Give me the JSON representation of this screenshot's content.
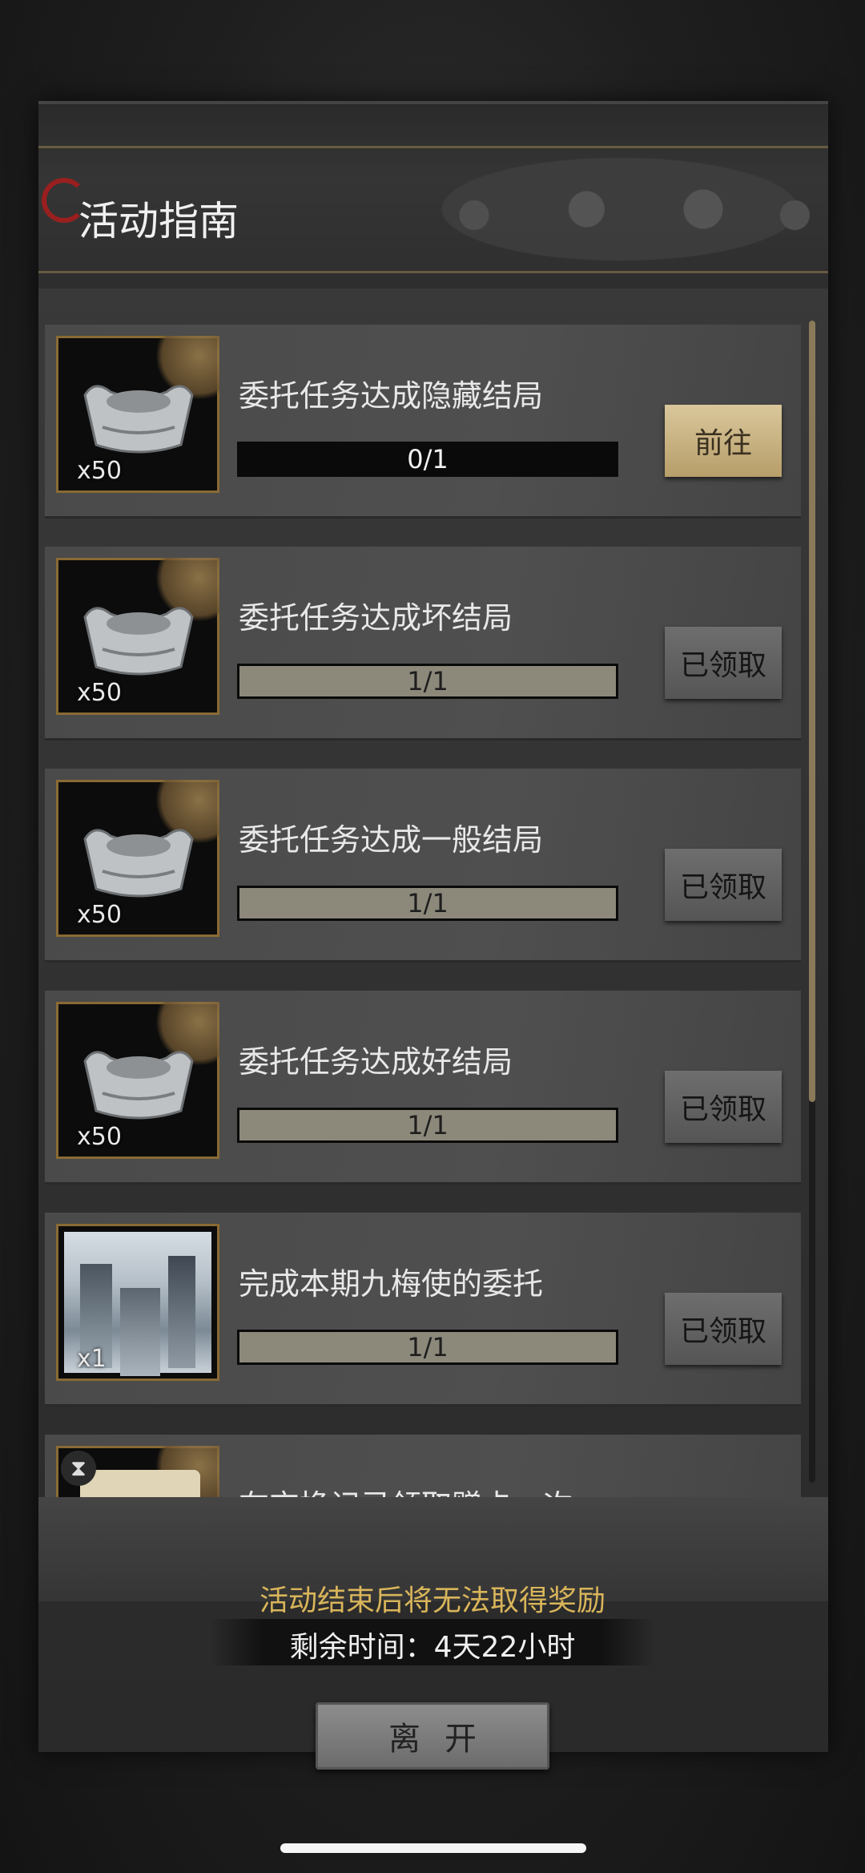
{
  "header": {
    "title": "活动指南"
  },
  "tasks": [
    {
      "title": "委托任务达成隐藏结局",
      "progress": "0/1",
      "progress_fraction": 0,
      "reward_qty": "x50",
      "reward_icon": "silver-ingot-icon",
      "button": "前往",
      "state": "go"
    },
    {
      "title": "委托任务达成坏结局",
      "progress": "1/1",
      "progress_fraction": 1,
      "reward_qty": "x50",
      "reward_icon": "silver-ingot-icon",
      "button": "已领取",
      "state": "claimed"
    },
    {
      "title": "委托任务达成一般结局",
      "progress": "1/1",
      "progress_fraction": 1,
      "reward_qty": "x50",
      "reward_icon": "silver-ingot-icon",
      "button": "已领取",
      "state": "claimed"
    },
    {
      "title": "委托任务达成好结局",
      "progress": "1/1",
      "progress_fraction": 1,
      "reward_qty": "x50",
      "reward_icon": "silver-ingot-icon",
      "button": "已领取",
      "state": "claimed"
    },
    {
      "title": "完成本期九梅使的委托",
      "progress": "1/1",
      "progress_fraction": 1,
      "reward_qty": "x1",
      "reward_icon": "landscape-scroll-icon",
      "button": "已领取",
      "state": "claimed"
    },
    {
      "title": "在交换记录领取赠卡一次",
      "reward_icon": "card-pack-icon"
    }
  ],
  "footer": {
    "warning": "活动结束后将无法取得奖励",
    "remaining_time": "剩余时间：4天22小时",
    "leave_button": "离开"
  },
  "colors": {
    "accent_gold": "#d9b55a",
    "go_button": "#c8b382",
    "progress_fill": "#8c887a",
    "title_mark_red": "#9a1f1f"
  }
}
